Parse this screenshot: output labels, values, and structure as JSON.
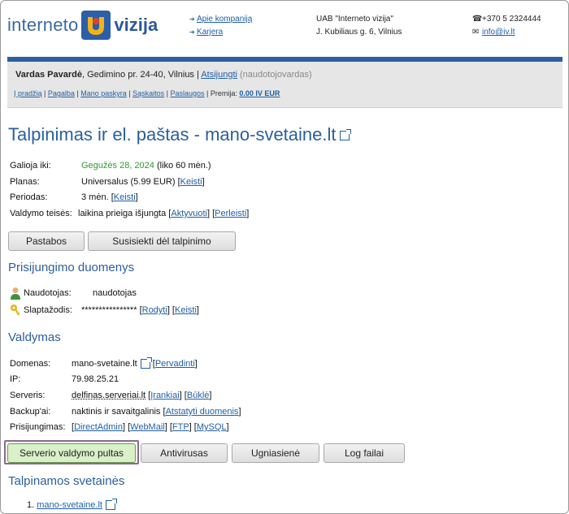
{
  "header": {
    "logo_left": "interneto",
    "logo_right": "vizija",
    "links": [
      "Apie kompaniją",
      "Karjera"
    ],
    "company_name": "UAB \"Interneto vizija\"",
    "company_address": "J. Kubiliaus g. 6, Vilnius",
    "phone": "+370 5 2324444",
    "email": "info@iv.lt"
  },
  "account": {
    "name": "Vardas Pavardė",
    "address": ", Gedimino pr. 24-40, Vilnius | ",
    "logout": "Atsijungti",
    "username_note": " (naudotojovardas)",
    "menu": [
      "Į pradžią",
      "Pagalba",
      "Mano paskyra",
      "Sąskaitos",
      "Paslaugos"
    ],
    "premium_label": "| Premija: ",
    "premium_value": "0.00 IV EUR"
  },
  "page_title": "Talpinimas ir el. paštas - mano-svetaine.lt",
  "info": {
    "valid_label": "Galioja iki:",
    "valid_date": "Gegužės 28, 2024",
    "valid_note": " (liko 60 mėn.)",
    "plan_label": "Planas:",
    "plan_value": "Universalus (5.99 EUR) ",
    "period_label": "Periodas:",
    "period_value": "3 mėn. ",
    "rights_label": "Valdymo teisės:",
    "rights_value": "laikina prieiga išjungta ",
    "change": "Keisti",
    "activate": "Aktyvuoti",
    "transfer": "Perleisti"
  },
  "buttons_top": [
    "Pastabos",
    "Susisiekti dėl talpinimo"
  ],
  "login_section": {
    "title": "Prisijungimo duomenys",
    "user_label": "Naudotojas:",
    "user_value": "naudotojas",
    "pass_label": "Slaptažodis:",
    "pass_value": "**************** ",
    "show": "Rodyti",
    "change": "Keisti"
  },
  "manage": {
    "title": "Valdymas",
    "domain_label": "Domenas:",
    "domain_value": "mano-svetaine.lt",
    "rename": "Pervadinti",
    "ip_label": "IP:",
    "ip_value": "79.98.25.21",
    "server_label": "Serveris:",
    "server_value": "delfinas.serveriai.lt",
    "tools": "Įrankiai",
    "status": "Būklė",
    "backup_label": "Backup'ai:",
    "backup_value": "naktinis ir savaitgalinis ",
    "restore": "Atstatyti duomenis",
    "access_label": "Prisijungimas:",
    "access_links": [
      "DirectAdmin",
      "WebMail",
      "FTP",
      "MySQL"
    ]
  },
  "buttons_bottom": [
    "Serverio valdymo pultas",
    "Antivirusas",
    "Ugniasienė",
    "Log failai"
  ],
  "hosted": {
    "title": "Talpinamos svetainės",
    "sites": [
      "mano-svetaine.lt"
    ]
  }
}
